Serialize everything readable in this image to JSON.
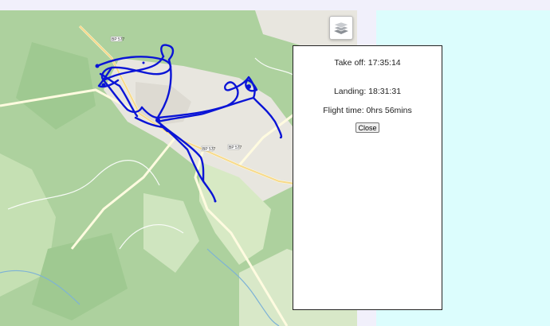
{
  "map": {
    "road_labels": [
      "BP 577",
      "BP 577",
      "BP 577"
    ],
    "track_color": "#0a14d6",
    "forest_color": "#add19e",
    "open_color": "#e8e6df"
  },
  "layers_control": {
    "icon": "layers-icon"
  },
  "popup": {
    "takeoff": "Take off: 17:35:14",
    "landing": "Landing: 18:31:31",
    "flight_time": "Flight time: 0hrs 56mins",
    "close_label": "Close"
  }
}
